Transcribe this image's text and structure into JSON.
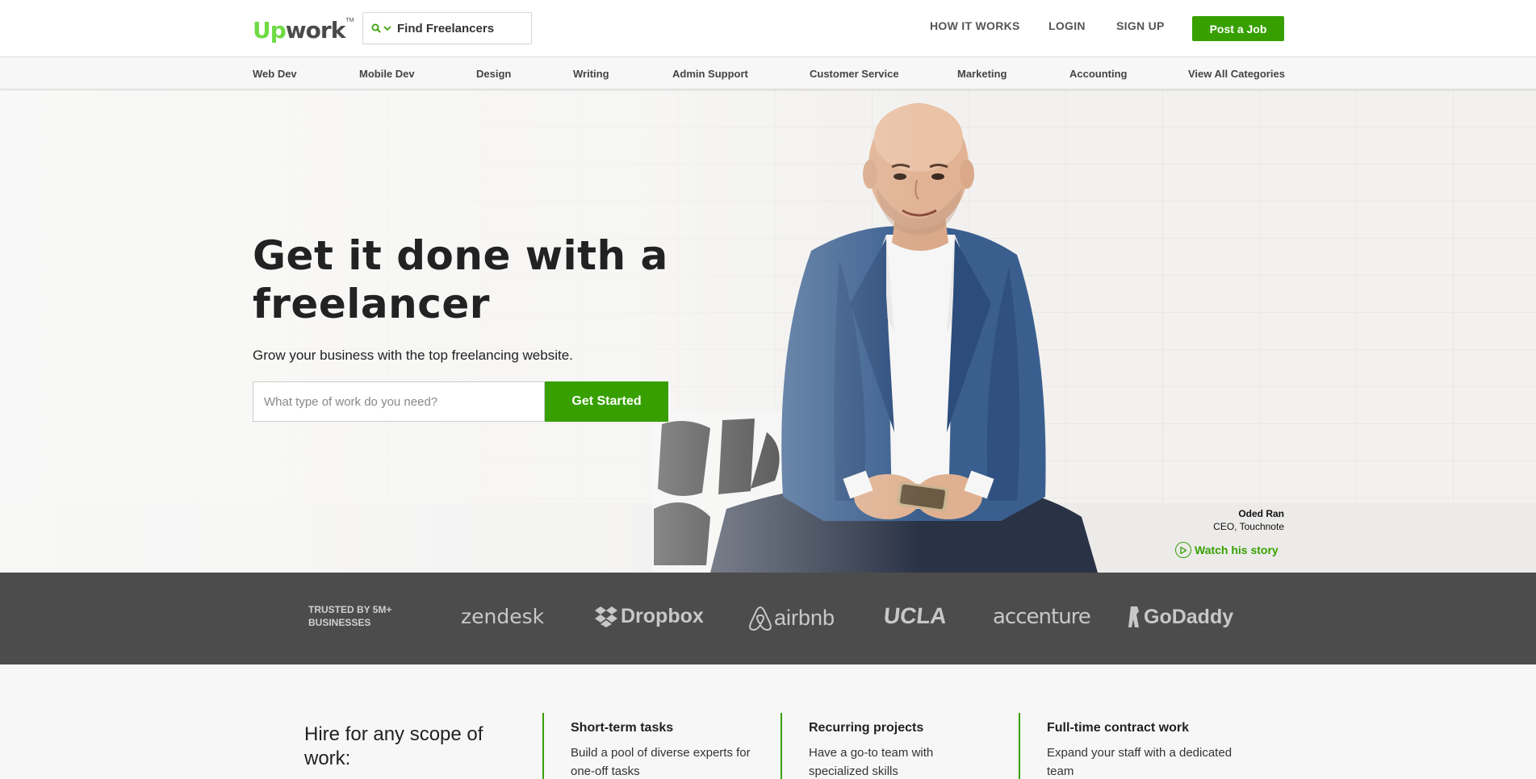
{
  "header": {
    "logo_up": "Up",
    "logo_work": "work",
    "logo_tm": "TM",
    "search_label": "Find Freelancers",
    "nav": [
      "HOW IT WORKS",
      "LOGIN",
      "SIGN UP"
    ],
    "post_job": "Post a Job"
  },
  "categories": [
    "Web Dev",
    "Mobile Dev",
    "Design",
    "Writing",
    "Admin Support",
    "Customer Service",
    "Marketing",
    "Accounting",
    "View All Categories"
  ],
  "hero": {
    "title": "Get it done with a freelancer",
    "subtitle": "Grow your business with the top freelancing website.",
    "input_placeholder": "What type of work do you need?",
    "cta": "Get Started",
    "person_name": "Oded Ran",
    "person_role": "CEO, Touchnote",
    "watch_story": "Watch his story"
  },
  "trusted": {
    "label": "TRUSTED BY 5M+ BUSINESSES",
    "brands": [
      "zendesk",
      "Dropbox",
      "airbnb",
      "UCLA",
      "accenture",
      "GoDaddy"
    ]
  },
  "scope": {
    "title": "Hire for any scope of work:",
    "columns": [
      {
        "heading": "Short-term tasks",
        "text": "Build a pool of diverse experts for one-off tasks"
      },
      {
        "heading": "Recurring projects",
        "text": "Have a go-to team with specialized skills"
      },
      {
        "heading": "Full-time contract work",
        "text": "Expand your staff with a dedicated team"
      }
    ]
  },
  "colors": {
    "brand_green": "#37a000",
    "logo_green": "#6fda44",
    "trusted_bg": "#4c4c4c"
  }
}
